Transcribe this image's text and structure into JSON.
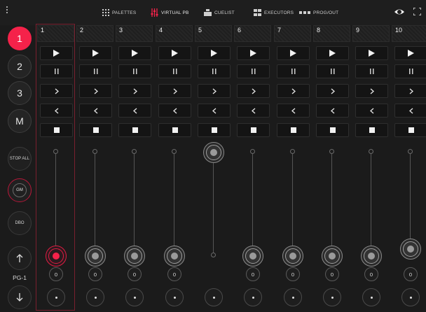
{
  "nav": {
    "items": [
      {
        "label": "PALETTES",
        "icon": "grid-icon",
        "active": false
      },
      {
        "label": "VIRTUAL PB",
        "icon": "sliders-icon",
        "active": true
      },
      {
        "label": "CUELIST",
        "icon": "cuelist-icon",
        "active": false
      },
      {
        "label": "EXECUTORS",
        "icon": "executors-icon",
        "active": false
      },
      {
        "label": "PROG/OUT",
        "icon": "progout-icon",
        "active": false
      }
    ]
  },
  "left": {
    "pages": [
      {
        "label": "1",
        "active": true
      },
      {
        "label": "2",
        "active": false
      },
      {
        "label": "3",
        "active": false
      },
      {
        "label": "M",
        "active": false
      }
    ],
    "stop_all": "STOP ALL",
    "gm": "GM",
    "dbo": "DBO",
    "page_label": "PG-1"
  },
  "playbacks": [
    {
      "number": "1",
      "value": "0",
      "level": 0.0,
      "selected": true
    },
    {
      "number": "2",
      "value": "0",
      "level": 0.0,
      "selected": false
    },
    {
      "number": "3",
      "value": "0",
      "level": 0.0,
      "selected": false
    },
    {
      "number": "4",
      "value": "0",
      "level": 0.0,
      "selected": false
    },
    {
      "number": "5",
      "value": "",
      "level": 1.0,
      "selected": false
    },
    {
      "number": "6",
      "value": "0",
      "level": 0.0,
      "selected": false
    },
    {
      "number": "7",
      "value": "0",
      "level": 0.0,
      "selected": false
    },
    {
      "number": "8",
      "value": "0",
      "level": 0.0,
      "selected": false
    },
    {
      "number": "9",
      "value": "0",
      "level": 0.0,
      "selected": false
    },
    {
      "number": "10",
      "value": "0",
      "level": 0.07,
      "selected": false
    }
  ],
  "colors": {
    "accent": "#f5224a",
    "background": "#1b1b1b"
  }
}
